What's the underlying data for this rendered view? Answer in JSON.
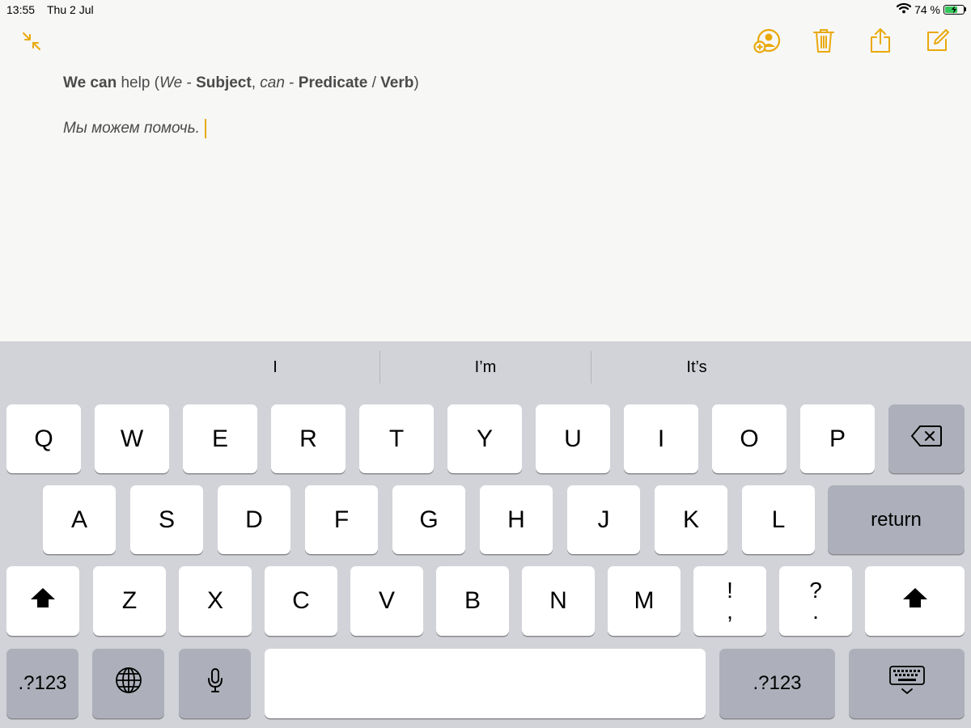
{
  "status_bar": {
    "time": "13:55",
    "date": "Thu 2 Jul",
    "battery_percent": "74 %",
    "battery_level": 0.74
  },
  "toolbar": {
    "collapse_icon": "collapse-arrows-icon",
    "share_person_icon": "add-person-icon",
    "trash_icon": "trash-icon",
    "share_icon": "share-icon",
    "compose_icon": "compose-icon",
    "accent_color": "#e9a90b"
  },
  "note": {
    "line1": {
      "we_can": "We can",
      "help": " help (",
      "we": "We",
      "dash1": " - ",
      "subject": "Subject",
      "comma": ", ",
      "can": "can",
      "dash2": " - ",
      "predicate": "Predicate",
      "slash": " / ",
      "verb": "Verb",
      "close": ")"
    },
    "line2": "Мы можем помочь."
  },
  "keyboard": {
    "predictions": [
      "I",
      "I’m",
      "It’s"
    ],
    "row1": [
      "Q",
      "W",
      "E",
      "R",
      "T",
      "Y",
      "U",
      "I",
      "O",
      "P"
    ],
    "row2": [
      "A",
      "S",
      "D",
      "F",
      "G",
      "H",
      "J",
      "K",
      "L"
    ],
    "return_label": "return",
    "row3": [
      "Z",
      "X",
      "C",
      "V",
      "B",
      "N",
      "M"
    ],
    "punct1_top": "!",
    "punct1_bottom": ",",
    "punct2_top": "?",
    "punct2_bottom": ".",
    "numbers_label": ".?123",
    "colors": {
      "background": "#d2d3d8",
      "key": "#ffffff",
      "special_key": "#adb0ba"
    }
  }
}
